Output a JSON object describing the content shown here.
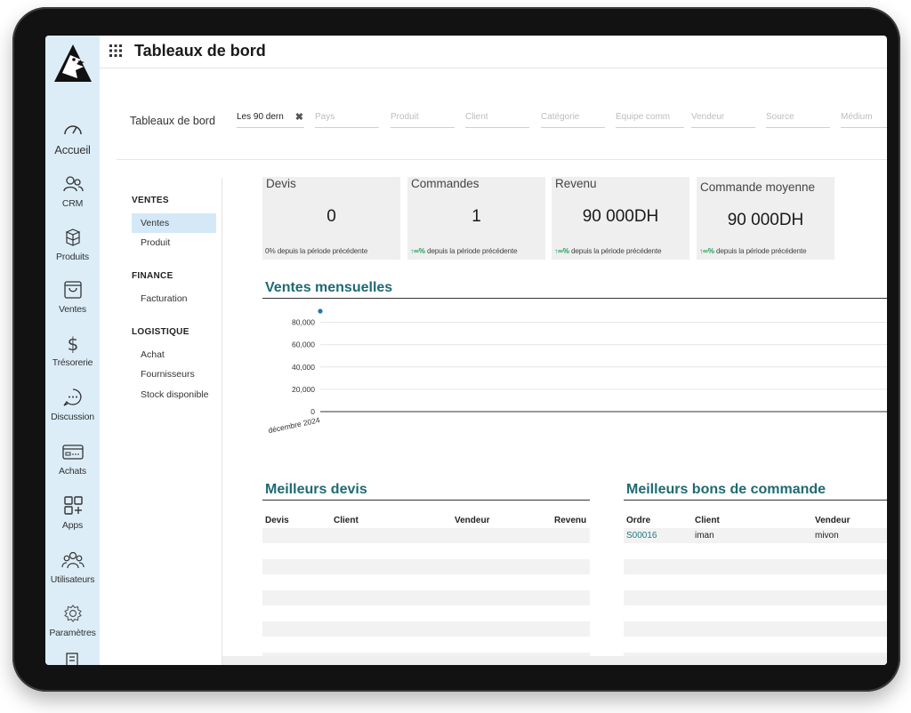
{
  "app": {
    "title": "Tableaux de bord"
  },
  "sidebar": {
    "items": [
      {
        "label": "Accueil",
        "icon": "gauge-icon"
      },
      {
        "label": "CRM",
        "icon": "users-icon"
      },
      {
        "label": "Produits",
        "icon": "boxes-icon"
      },
      {
        "label": "Ventes",
        "icon": "shopping-bag-icon"
      },
      {
        "label": "Trésorerie",
        "icon": "dollar-icon"
      },
      {
        "label": "Discussion",
        "icon": "chat-bubble-icon"
      },
      {
        "label": "Achats",
        "icon": "credit-card-icon"
      },
      {
        "label": "Apps",
        "icon": "apps-grid-plus-icon"
      },
      {
        "label": "Utilisateurs",
        "icon": "user-group-icon"
      },
      {
        "label": "Paramètres",
        "icon": "gear-icon"
      }
    ]
  },
  "filters": {
    "label": "Tableaux de bord",
    "period": "Les 90 dern",
    "placeholders": [
      "Pays",
      "Produit",
      "Client",
      "Catégorie",
      "Équipe comm",
      "Vendeur",
      "Source",
      "Médium"
    ]
  },
  "menu": {
    "sections": [
      {
        "title": "VENTES",
        "items": [
          "Ventes",
          "Produit"
        ]
      },
      {
        "title": "FINANCE",
        "items": [
          "Facturation"
        ]
      },
      {
        "title": "LOGISTIQUE",
        "items": [
          "Achat",
          "Fournisseurs",
          "Stock disponible"
        ]
      }
    ],
    "selected": "Ventes"
  },
  "kpis": [
    {
      "title": "Devis",
      "value": "0",
      "trend_mark": "",
      "trend": "0% depuis la période précédente"
    },
    {
      "title": "Commandes",
      "value": "1",
      "trend_mark": "↑∞%",
      "trend": " depuis la période précédente"
    },
    {
      "title": "Revenu",
      "value": "90 000DH",
      "trend_mark": "↑∞%",
      "trend": " depuis la période précédente"
    },
    {
      "title": "Commande moyenne",
      "value": "90 000DH",
      "trend_mark": "↑∞%",
      "trend": " depuis la période précédente"
    }
  ],
  "monthly_sales": {
    "title": "Ventes mensuelles",
    "colors": {
      "point": "#1f77b4",
      "grid": "#e6e6e6",
      "axis": "#333333"
    }
  },
  "chart_data": {
    "type": "line",
    "categories": [
      "décembre 2024"
    ],
    "series": [
      {
        "values": [
          90000
        ]
      }
    ],
    "yticks": [
      "0",
      "20,000",
      "40,000",
      "60,000",
      "80,000"
    ],
    "ylim": [
      0,
      90000
    ],
    "grid": true
  },
  "top_quotes": {
    "title": "Meilleurs devis",
    "columns": [
      "Devis",
      "Client",
      "Vendeur",
      "Revenu"
    ],
    "rows": []
  },
  "top_orders": {
    "title": "Meilleurs bons de commande",
    "columns": [
      "Ordre",
      "Client",
      "Vendeur"
    ],
    "rows": [
      {
        "order": "S00016",
        "client": "iman",
        "seller": "mivon"
      }
    ]
  },
  "colors": {
    "accent": "#1f6a73",
    "sidebar_bg": "#dcedf8",
    "selected_bg": "#d4e8f7",
    "trend_up": "#21a05c"
  }
}
